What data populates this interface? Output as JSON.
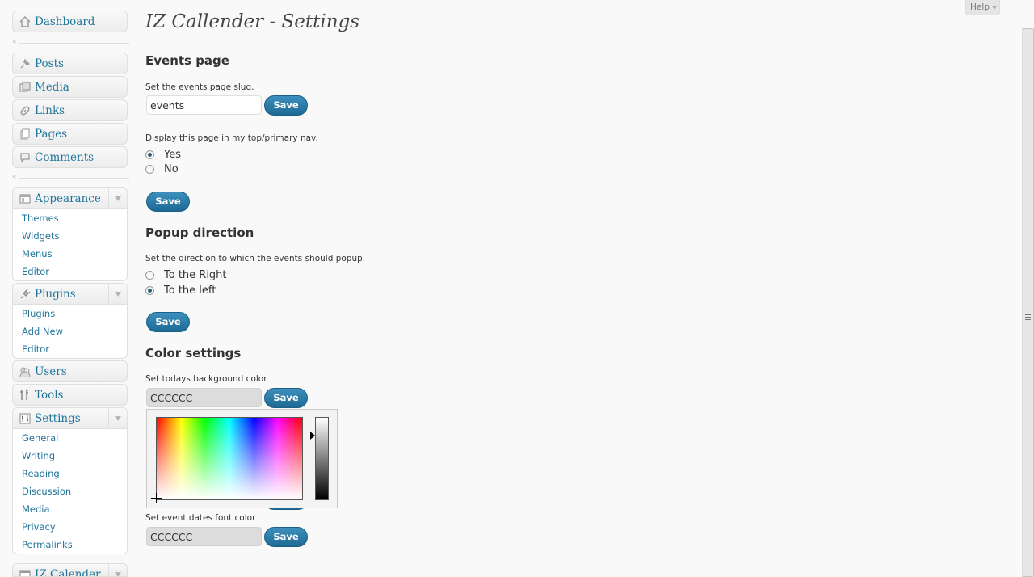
{
  "sidebar": {
    "dashboard": "Dashboard",
    "posts": "Posts",
    "media": "Media",
    "links": "Links",
    "pages": "Pages",
    "comments": "Comments",
    "appearance": {
      "label": "Appearance",
      "items": [
        "Themes",
        "Widgets",
        "Menus",
        "Editor"
      ]
    },
    "plugins": {
      "label": "Plugins",
      "items": [
        "Plugins",
        "Add New",
        "Editor"
      ]
    },
    "users": "Users",
    "tools": "Tools",
    "settings": {
      "label": "Settings",
      "items": [
        "General",
        "Writing",
        "Reading",
        "Discussion",
        "Media",
        "Privacy",
        "Permalinks"
      ]
    },
    "izcalender": "IZ Calender"
  },
  "header": {
    "help_label": "Help",
    "title": "IZ Callender - Settings"
  },
  "events_page": {
    "heading": "Events page",
    "slug_desc": "Set the events page slug.",
    "slug_value": "events",
    "save_label": "Save",
    "nav_desc": "Display this page in my top/primary nav.",
    "opt_yes": "Yes",
    "opt_no": "No",
    "selected": "Yes",
    "save2_label": "Save"
  },
  "popup": {
    "heading": "Popup direction",
    "desc": "Set the direction to which the events should popup.",
    "opt_right": "To the Right",
    "opt_left": "To the left",
    "selected": "To the left",
    "save_label": "Save"
  },
  "colors": {
    "heading": "Color settings",
    "today_desc": "Set todays background color",
    "today_value": "CCCCCC",
    "today_save": "Save",
    "dates_desc": "Set event dates font color",
    "dates_value": "CCCCCC",
    "dates_save": "Save"
  }
}
